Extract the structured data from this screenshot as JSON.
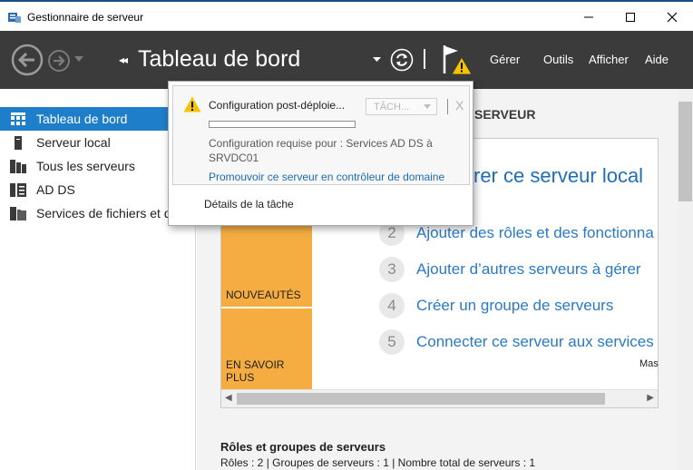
{
  "window": {
    "title": "Gestionnaire de serveur"
  },
  "toolbar": {
    "breadcrumb_arrows": "◂◂",
    "title": "Tableau de bord",
    "menus": [
      {
        "label": "Gérer"
      },
      {
        "label": "Outils"
      },
      {
        "label": "Afficher"
      },
      {
        "label": "Aide"
      }
    ]
  },
  "sidebar": {
    "items": [
      {
        "label": "Tableau de bord",
        "icon": "dashboard-icon",
        "active": true
      },
      {
        "label": "Serveur local",
        "icon": "server-icon"
      },
      {
        "label": "Tous les serveurs",
        "icon": "servers-icon"
      },
      {
        "label": "AD DS",
        "icon": "ad-ds-icon"
      },
      {
        "label": "Services de fichiers et d"
      }
    ]
  },
  "main": {
    "welcome_title": "SERVEUR",
    "configure_local": "rer ce serveur local",
    "steps": [
      {
        "num": "2",
        "text": "Ajouter des rôles et des fonctionna"
      },
      {
        "num": "3",
        "text": "Ajouter d’autres serveurs à gérer"
      },
      {
        "num": "4",
        "text": "Créer un groupe de serveurs"
      },
      {
        "num": "5",
        "text": "Connecter ce serveur aux services"
      }
    ],
    "tiles": {
      "whats_new": "NOUVEAUTÉS",
      "learn_more": "EN SAVOIR PLUS"
    },
    "mask_label": "Mas",
    "roles_title": "Rôles et groupes de serveurs",
    "roles_stats": "Rôles : 2   |   Groupes de serveurs : 1   |   Nombre total de serveurs : 1"
  },
  "notification": {
    "title": "Configuration post-déploie...",
    "tasks_button": "TÂCH...",
    "close": "X",
    "progress": 0,
    "requirement": "Configuration requise pour : Services AD DS à SRVDC01",
    "promote_link": "Promouvoir ce serveur en contrôleur de domaine",
    "details_link": "Détails de la tâche"
  },
  "colors": {
    "toolbar_bg": "#3b3b3b",
    "accent": "#1f7ec9",
    "tile_orange": "#f5ad41",
    "link_blue": "#1f6fb8",
    "warning_yellow": "#f4c400"
  }
}
